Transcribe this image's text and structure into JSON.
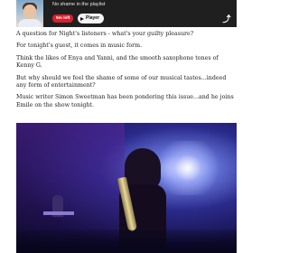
{
  "player": {
    "episode_title": "No shame in the playlist",
    "duration": "9m left",
    "play_label": "Player",
    "brand_glyph": "⤴"
  },
  "article": {
    "paragraphs": [
      "A question for Night's listeners - what's your guilty pleasure?",
      "For tonight's guest, it comes in music form.",
      "Think the likes of Enya and Yanni, and the smooth saxophone tones of Kenny G.",
      "But why should we feel the shame of some of our musical tastes...indeed any form of entertainment?",
      "Music writer Simon Sweetman has been pondering this issue...and he joins Emile on the show tonight."
    ]
  },
  "colors": {
    "player_background": "#1f1f1f",
    "duration_pill": "#d6202e"
  }
}
